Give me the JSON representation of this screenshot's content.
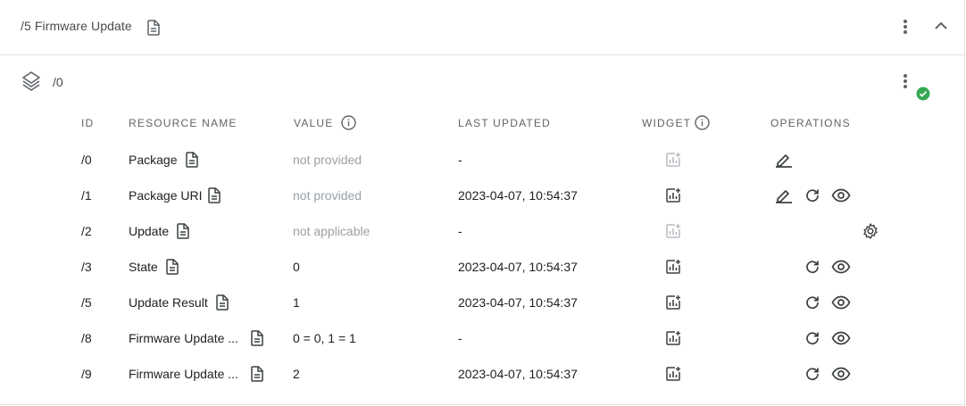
{
  "header": {
    "title": "/5 Firmware Update"
  },
  "instance": {
    "label": "/0",
    "status": "ok"
  },
  "columns": {
    "id": "ID",
    "resource_name": "RESOURCE NAME",
    "value": "VALUE",
    "last_updated": "LAST UPDATED",
    "widget": "WIDGET",
    "operations": "OPERATIONS"
  },
  "rows": [
    {
      "id": "/0",
      "name": "Package",
      "value": "not provided",
      "value_muted": true,
      "last_updated": "-",
      "widget_enabled": false,
      "ops": [
        "write"
      ]
    },
    {
      "id": "/1",
      "name": "Package URI",
      "value": "not provided",
      "value_muted": true,
      "last_updated": "2023-04-07, 10:54:37",
      "widget_enabled": true,
      "ops": [
        "write",
        "refresh",
        "observe"
      ]
    },
    {
      "id": "/2",
      "name": "Update",
      "value": "not applicable",
      "value_muted": true,
      "last_updated": "-",
      "widget_enabled": false,
      "ops": [
        "execute"
      ]
    },
    {
      "id": "/3",
      "name": "State",
      "value": "0",
      "value_muted": false,
      "last_updated": "2023-04-07, 10:54:37",
      "widget_enabled": true,
      "ops": [
        "refresh",
        "observe"
      ]
    },
    {
      "id": "/5",
      "name": "Update Result",
      "value": "1",
      "value_muted": false,
      "last_updated": "2023-04-07, 10:54:37",
      "widget_enabled": true,
      "ops": [
        "refresh",
        "observe"
      ]
    },
    {
      "id": "/8",
      "name": "Firmware Update ...",
      "value": "0 = 0, 1 = 1",
      "value_muted": false,
      "last_updated": "-",
      "widget_enabled": true,
      "ops": [
        "refresh",
        "observe"
      ]
    },
    {
      "id": "/9",
      "name": "Firmware Update ...",
      "value": "2",
      "value_muted": false,
      "last_updated": "2023-04-07, 10:54:37",
      "widget_enabled": true,
      "ops": [
        "refresh",
        "observe"
      ]
    }
  ],
  "icons": {
    "doc": "document-icon",
    "more": "more-vert-icon",
    "collapse": "chevron-up-icon",
    "instance": "layers-icon",
    "status": "check-circle-icon",
    "info": "info-icon",
    "widget": "add-chart-icon",
    "write": "edit-icon",
    "refresh": "refresh-icon",
    "observe": "eye-icon",
    "execute": "settings-gear-icon"
  },
  "colors": {
    "status_ok": "#34a853",
    "muted_text": "#9aa0a6",
    "text": "#202124"
  }
}
